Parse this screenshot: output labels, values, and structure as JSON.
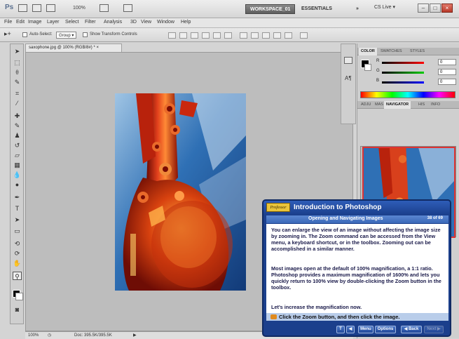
{
  "appbar": {
    "logo": "Ps",
    "zoom": "100%",
    "workspace_active": "WORKSPACE_01",
    "workspace_alt": "ESSENTIALS",
    "more": "»",
    "cslive": "CS Live ▾"
  },
  "menu": [
    "File",
    "Edit",
    "Image",
    "Layer",
    "Select",
    "Filter",
    "Analysis",
    "3D",
    "View",
    "Window",
    "Help"
  ],
  "options": {
    "auto_select_label": "Auto-Select:",
    "auto_select_value": "Group",
    "transform_label": "Show Transform Controls"
  },
  "document": {
    "tab_title": "saxophone.jpg @ 100% (RGB/8#) *",
    "status_zoom": "100%",
    "status_doc": "Doc: 395.5K/395.5K"
  },
  "panels": {
    "color_tabs": [
      "COLOR",
      "SWATCHES",
      "STYLES"
    ],
    "rgb": [
      {
        "label": "R",
        "value": "0",
        "color": "#d02020"
      },
      {
        "label": "G",
        "value": "0",
        "color": "#20a020"
      },
      {
        "label": "B",
        "value": "0",
        "color": "#2040d0"
      }
    ],
    "nav_tabs": [
      "ADJU",
      "MAS",
      "NAVIGATOR",
      "HIS",
      "INFO"
    ]
  },
  "tutorial": {
    "logo": "Professor",
    "title": "Introduction to Photoshop",
    "subtitle": "Opening and Navigating Images",
    "count": "38 of 69",
    "paragraphs": [
      "You can enlarge the view of an image without affecting the image size by zooming in. The Zoom command can be accessed from the View menu, a keyboard shortcut, or in the toolbox. Zooming out can be accomplished in a similar manner.",
      "Most images open at the default of 100% magnification, a 1:1 ratio. Photoshop provides a maximum magnification of 1600% and lets you quickly return to 100% view by double-clicking the Zoom button in the toolbox.",
      "Let's increase the magnification now."
    ],
    "instruction": "Click the Zoom button, and then click the image.",
    "buttons": {
      "text": "T",
      "audio": "◀",
      "menu": "Menu",
      "options": "Options",
      "back": "◀ Back",
      "next": "Next ▶"
    }
  },
  "colors": {
    "accent": "#1b3f8c",
    "arrow": "#e0201c"
  }
}
